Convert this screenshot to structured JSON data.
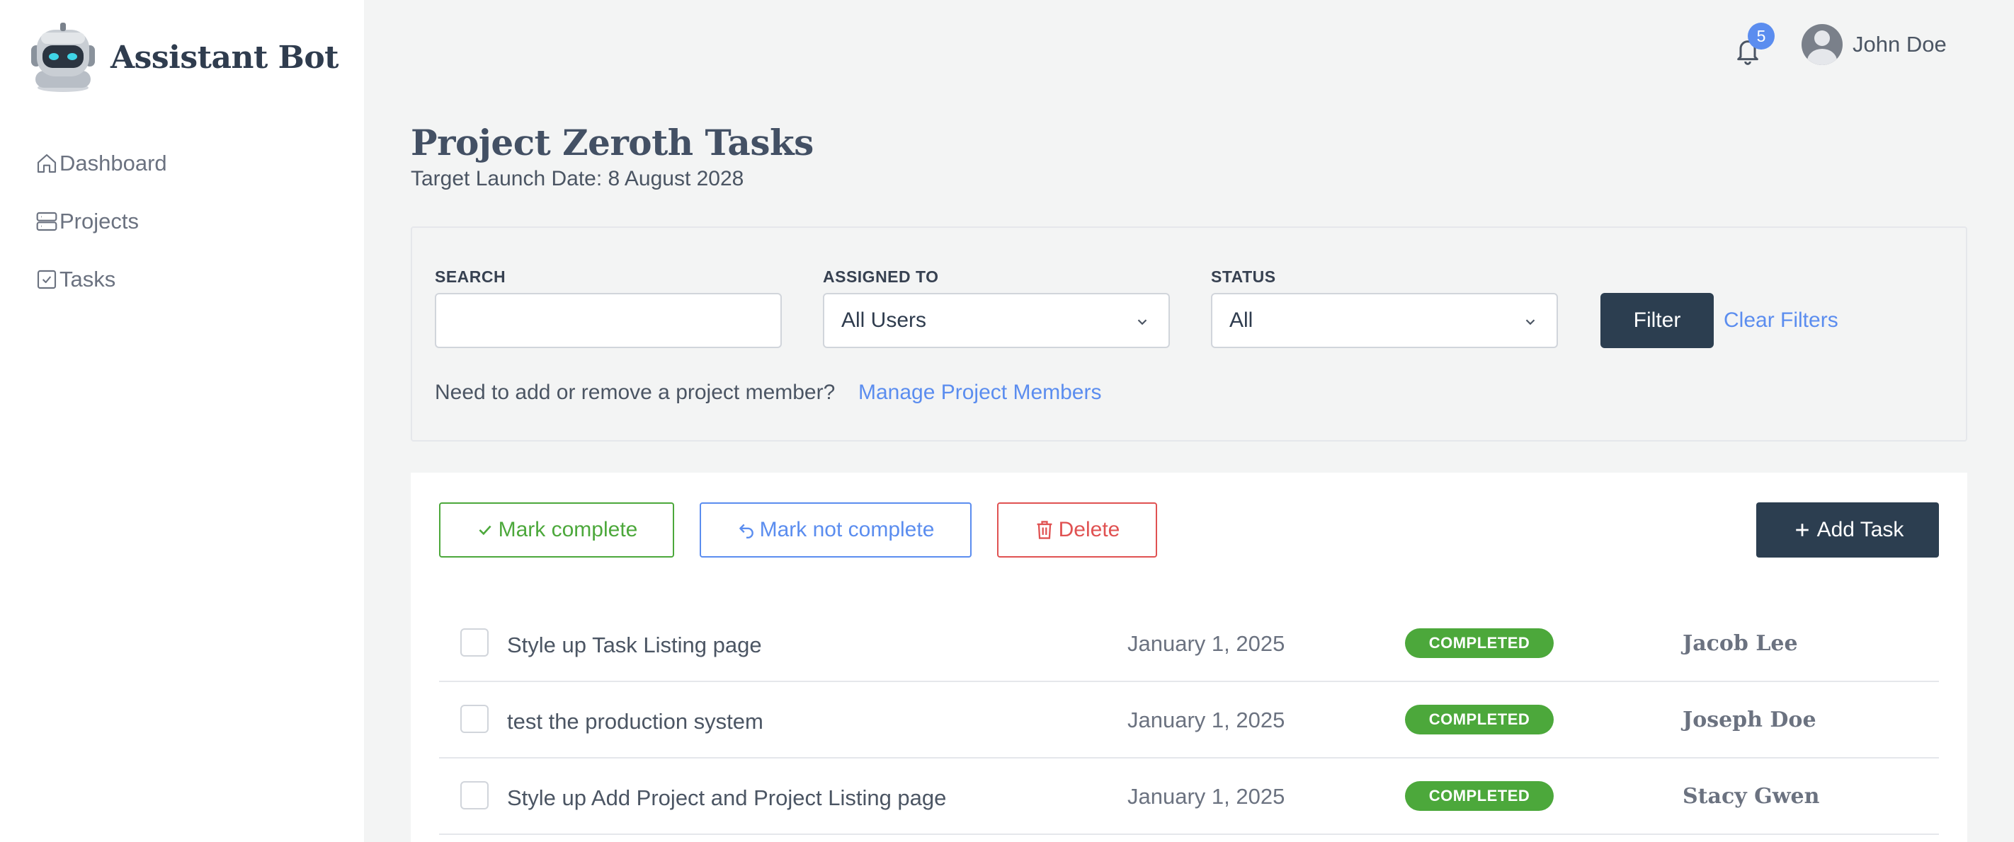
{
  "brand": {
    "name": "Assistant Bot",
    "logo_icon": "robot-icon"
  },
  "sidebar": {
    "items": [
      {
        "label": "Dashboard",
        "icon": "home-icon"
      },
      {
        "label": "Projects",
        "icon": "server-icon"
      },
      {
        "label": "Tasks",
        "icon": "check-square-icon"
      }
    ]
  },
  "header": {
    "notification_count": "5",
    "user_name": "John Doe"
  },
  "page": {
    "title": "Project Zeroth Tasks",
    "subtitle": "Target Launch Date: 8 August 2028"
  },
  "filters": {
    "search_label": "SEARCH",
    "search_value": "",
    "assigned_label": "ASSIGNED TO",
    "assigned_value": "All Users",
    "status_label": "STATUS",
    "status_value": "All",
    "filter_button": "Filter",
    "clear_link": "Clear Filters",
    "member_text": "Need to add or remove a project member?",
    "member_link": "Manage Project Members"
  },
  "actions": {
    "mark_complete": "Mark complete",
    "mark_not_complete": "Mark not complete",
    "delete": "Delete",
    "add_task": "Add Task"
  },
  "tasks": [
    {
      "title": "Style up Task Listing page",
      "date": "January 1, 2025",
      "status": "COMPLETED",
      "assignee": "Jacob Lee"
    },
    {
      "title": "test the production system",
      "date": "January 1, 2025",
      "status": "COMPLETED",
      "assignee": "Joseph Doe"
    },
    {
      "title": "Style up Add Project and Project Listing page",
      "date": "January 1, 2025",
      "status": "COMPLETED",
      "assignee": "Stacy Gwen"
    }
  ],
  "colors": {
    "primary_dark": "#2c3e50",
    "link_blue": "#5b8def",
    "success_green": "#4ca83b",
    "danger_red": "#e05252",
    "background": "#f3f4f4"
  }
}
